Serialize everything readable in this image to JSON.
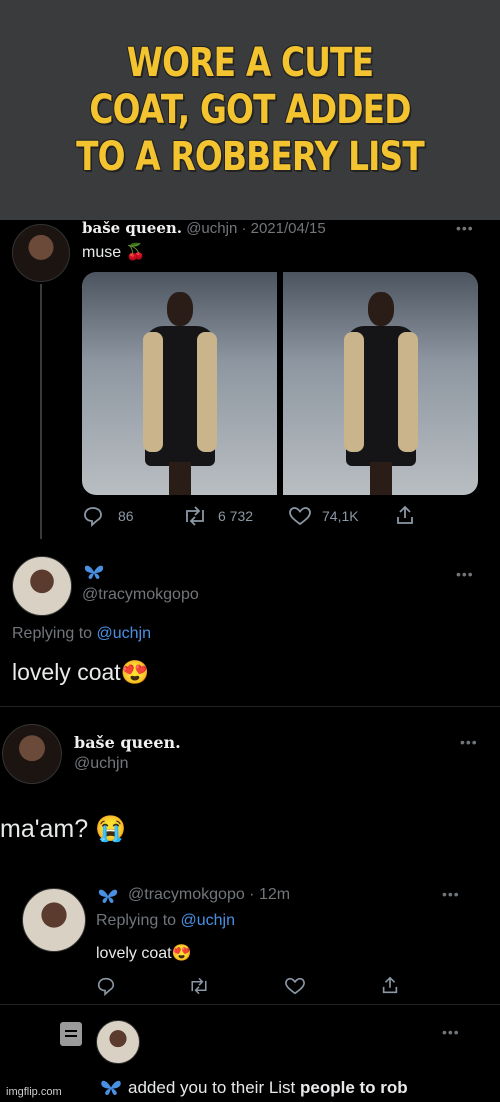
{
  "meme": {
    "line1": "WORE A CUTE",
    "line2": "COAT, GOT ADDED",
    "line3": "TO A ROBBERY LIST"
  },
  "tweet1": {
    "display_name": "baše queen.",
    "meta": "@uchjn · 2021/04/15",
    "text": "muse 🍒",
    "stats": {
      "replies": "86",
      "retweets": "6 732",
      "likes": "74,1K"
    }
  },
  "reply1": {
    "display_name_icon": "butterfly-icon",
    "handle": "@tracymokgopo",
    "replying_prefix": "Replying to ",
    "replying_to": "@uchjn",
    "text": "lovely coat😍"
  },
  "tweet2": {
    "display_name": "baše queen.",
    "handle": "@uchjn",
    "text": "ma'am? 😭"
  },
  "quoted": {
    "meta": "@tracymokgopo · 12m",
    "replying_prefix": "Replying to ",
    "replying_to": "@uchjn",
    "text": "lovely coat😍"
  },
  "notification": {
    "prefix": "added you to their List ",
    "list_name": "people to rob"
  },
  "watermark": "imgflip.com",
  "colors": {
    "meme_text": "#f4c430",
    "link": "#4a90e2",
    "muted": "#71767b"
  }
}
